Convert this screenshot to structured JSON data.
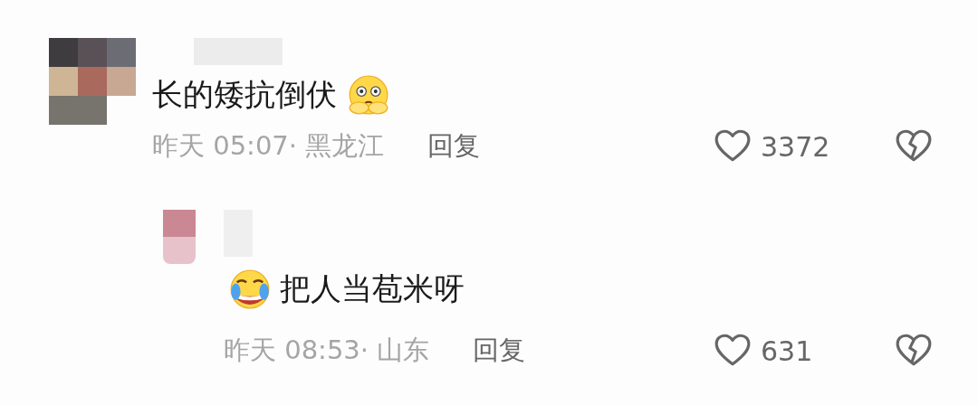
{
  "comments": [
    {
      "text": "长的矮抗倒伏",
      "kind": "thinking",
      "time": "昨天 05:07· 黑龙江",
      "reply": "回复",
      "likes": "3372",
      "liked": false,
      "replies": [
        {
          "text": "把人当苞米呀",
          "kind": "laughing",
          "time": "昨天 08:53· 山东",
          "reply": "回复",
          "likes": "631",
          "liked": false
        }
      ]
    }
  ]
}
